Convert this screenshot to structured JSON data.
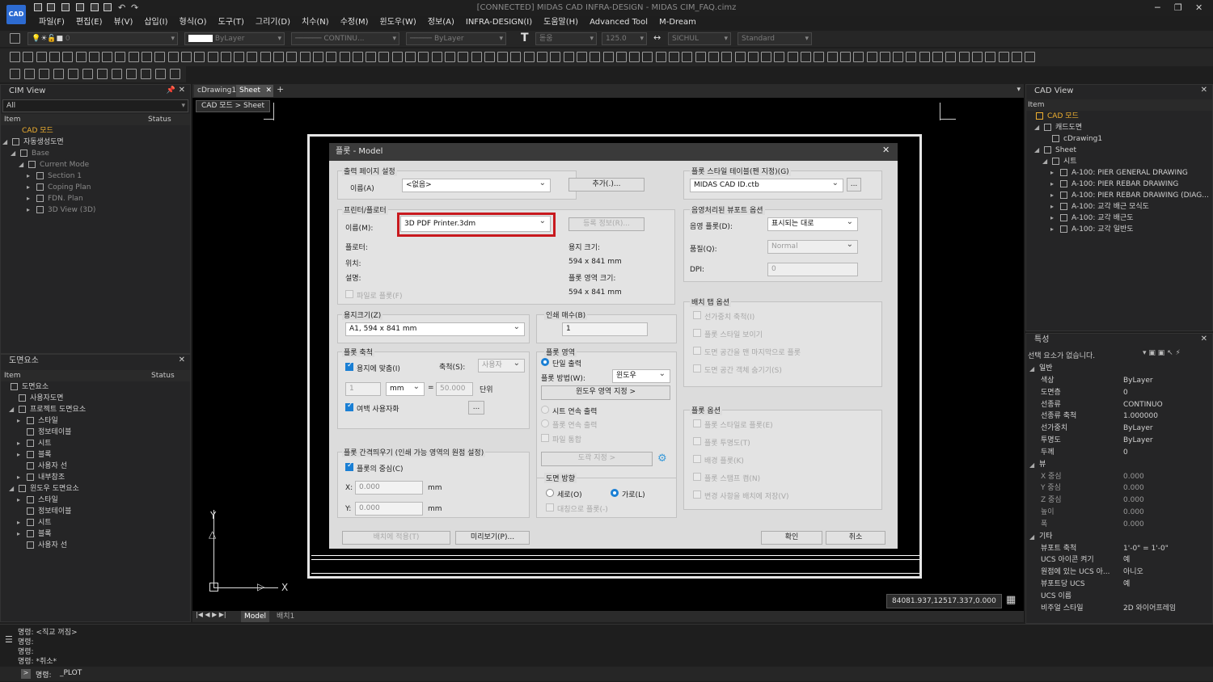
{
  "app": {
    "title": "[CONNECTED] MIDAS CAD INFRA-DESIGN - MIDAS CIM_FAQ.cimz",
    "logo": "CAD"
  },
  "menu": [
    "파일(F)",
    "편집(E)",
    "뷰(V)",
    "삽입(I)",
    "형식(O)",
    "도구(T)",
    "그리기(D)",
    "치수(N)",
    "수정(M)",
    "윈도우(W)",
    "정보(A)",
    "INFRA-DESIGN(I)",
    "도움말(H)",
    "Advanced Tool",
    "M-Dream"
  ],
  "toolbar": {
    "layer": "0",
    "color": "ByLayer",
    "linetype": "CONTINU...",
    "lineweight": "ByLayer",
    "textstyle": "돋움",
    "textheight": "125.0",
    "dimstyle": "SICHUL",
    "style2": "Standard"
  },
  "cim_view": {
    "title": "CIM View",
    "filter": "All",
    "col_item": "Item",
    "col_status": "Status",
    "items": [
      {
        "label": "CAD 모드",
        "level": 0
      },
      {
        "label": "자동생성도면",
        "level": 0
      },
      {
        "label": "Base",
        "level": 1
      },
      {
        "label": "Current Mode",
        "level": 2
      },
      {
        "label": "Section 1",
        "level": 3
      },
      {
        "label": "Coping Plan",
        "level": 3
      },
      {
        "label": "FDN. Plan",
        "level": 3
      },
      {
        "label": "3D View (3D)",
        "level": 3
      }
    ]
  },
  "drawing_elements": {
    "title": "도면요소",
    "col_item": "Item",
    "col_status": "Status",
    "items": [
      {
        "label": "도면요소",
        "level": 0
      },
      {
        "label": "사용자도면",
        "level": 1
      },
      {
        "label": "프로젝트 도면요소",
        "level": 1
      },
      {
        "label": "스타일",
        "level": 2
      },
      {
        "label": "정보테이블",
        "level": 2
      },
      {
        "label": "시트",
        "level": 2
      },
      {
        "label": "블록",
        "level": 2
      },
      {
        "label": "사용자 선",
        "level": 2
      },
      {
        "label": "내부참조",
        "level": 2
      },
      {
        "label": "윈도우 도면요소",
        "level": 1
      },
      {
        "label": "스타일",
        "level": 2
      },
      {
        "label": "정보테이블",
        "level": 2
      },
      {
        "label": "시트",
        "level": 2
      },
      {
        "label": "블록",
        "level": 2
      },
      {
        "label": "사용자 선",
        "level": 2
      }
    ]
  },
  "tabs": [
    "cDrawing1",
    "Sheet"
  ],
  "breadcrumb": "CAD 모드 > Sheet",
  "plot": {
    "title": "플롯 - Model",
    "page_setup": {
      "group": "출력 페이지 설정",
      "name_label": "이름(A)",
      "name_value": "<없음>",
      "add_button": "추가(.)..."
    },
    "printer": {
      "group": "프린터/플로터",
      "name_label": "이름(M):",
      "name_value": "3D PDF Printer.3dm",
      "props_button": "등록 정보(R)...",
      "plotter_label": "플로터:",
      "location_label": "위치:",
      "description_label": "설명:",
      "plot_to_file": "파일로 플롯(F)",
      "paper_size_label": "용지 크기:",
      "paper_size_value": "594 x 841 mm",
      "plot_area_label": "플롯 영역 크기:",
      "plot_area_value": "594 x 841 mm"
    },
    "paper_size": {
      "group": "용지크기(Z)",
      "value": "A1, 594 x 841 mm"
    },
    "copies": {
      "group": "인쇄 매수(B)",
      "value": "1"
    },
    "plot_scale": {
      "group": "플롯 축척",
      "fit": "용지에 맞춤(I)",
      "scale_label": "축척(S):",
      "scale_value": "사용자",
      "value1": "1",
      "unit": "mm",
      "equals": "=",
      "value2": "50.000",
      "unit_label": "단위",
      "margin": "여백 사용자화"
    },
    "plot_area": {
      "group": "플롯 영역",
      "single": "단일 출력",
      "method_label": "플롯 방법(W):",
      "method_value": "윈도우",
      "window_button": "윈도우 영역 지정 >",
      "sheet_series": "시트 연속 출력",
      "sheet_series2": "플롯 연속 출력",
      "merge": "파일 통합",
      "frame_button": "도곽 지정 >"
    },
    "offset": {
      "group": "플롯 간격띄우기 (인쇄 가능 영역의 원점 설정)",
      "center": "플롯의 중심(C)",
      "x_label": "X:",
      "x_value": "0.000",
      "y_label": "Y:",
      "y_value": "0.000",
      "unit": "mm"
    },
    "orientation": {
      "group": "도면 방향",
      "portrait": "세로(O)",
      "landscape": "가로(L)",
      "upside": "대칭으로 플롯(-)"
    },
    "style_table": {
      "group": "플롯 스타일 테이블(펜 지정)(G)",
      "value": "MIDAS CAD ID.ctb"
    },
    "shaded": {
      "group": "음영처리된 뷰포트 옵션",
      "shade_label": "음영 플롯(D):",
      "shade_value": "표시되는 대로",
      "quality_label": "품질(Q):",
      "quality_value": "Normal",
      "dpi_label": "DPI:",
      "dpi_value": "0"
    },
    "layout_options": {
      "group": "배치 탭 옵션",
      "opts": [
        "선가중치 축척(I)",
        "플롯 스타일 보이기",
        "도면 공간을 맨 마지막으로 플롯",
        "도면 공간 객체 숨기기(S)"
      ]
    },
    "plot_options": {
      "group": "플롯 옵션",
      "opts": [
        "플롯 스타일로 플롯(E)",
        "플롯 투명도(T)",
        "배경 플롯(K)",
        "플롯 스탬프 켬(N)",
        "변경 사항을 배치에 저장(V)"
      ]
    },
    "buttons": {
      "apply": "배치에 적용(T)",
      "preview": "미리보기(P)...",
      "ok": "확인",
      "cancel": "취소"
    }
  },
  "cad_view": {
    "title": "CAD View",
    "col_item": "Item",
    "items": [
      {
        "label": "CAD 모드",
        "level": 0
      },
      {
        "label": "캐드도면",
        "level": 1
      },
      {
        "label": "cDrawing1",
        "level": 2
      },
      {
        "label": "Sheet",
        "level": 1
      },
      {
        "label": "시트",
        "level": 2
      },
      {
        "label": "A-100: PIER GENERAL DRAWING",
        "level": 3
      },
      {
        "label": "A-100: PIER REBAR DRAWING",
        "level": 3
      },
      {
        "label": "A-100: PIER REBAR DRAWING (DIAG...",
        "level": 3
      },
      {
        "label": "A-100: 교각 배근 모식도",
        "level": 3
      },
      {
        "label": "A-100: 교각 배근도",
        "level": 3
      },
      {
        "label": "A-100: 교각 일반도",
        "level": 3
      }
    ]
  },
  "properties": {
    "title": "특성",
    "selection": "선택 요소가 없습니다.",
    "groups": [
      {
        "name": "일반",
        "rows": [
          [
            "색상",
            "ByLayer"
          ],
          [
            "도면층",
            "0"
          ],
          [
            "선종류",
            "CONTINUO"
          ],
          [
            "선종류 축척",
            "1.000000"
          ],
          [
            "선가중치",
            "ByLayer"
          ],
          [
            "투명도",
            "ByLayer"
          ],
          [
            "두께",
            "0"
          ]
        ]
      },
      {
        "name": "뷰",
        "rows": [
          [
            "X 중심",
            "0.000"
          ],
          [
            "Y 중심",
            "0.000"
          ],
          [
            "Z 중심",
            "0.000"
          ],
          [
            "높이",
            "0.000"
          ],
          [
            "폭",
            "0.000"
          ]
        ]
      },
      {
        "name": "기타",
        "rows": [
          [
            "뷰포트 축척",
            "1'-0\" = 1'-0\""
          ],
          [
            "UCS 아이콘 켜기",
            "예"
          ],
          [
            "원점에 있는 UCS 아...",
            "아니오"
          ],
          [
            "뷰포트당 UCS",
            "예"
          ],
          [
            "UCS 이름",
            ""
          ],
          [
            "비주얼 스타일",
            "2D 와이어프레임"
          ]
        ]
      }
    ]
  },
  "layout_tabs": {
    "model": "Model",
    "layout1": "배치1"
  },
  "coords": "84081.937,12517.337,0.000",
  "axis": {
    "x": "X",
    "y": "Y"
  },
  "command": {
    "lines": [
      "명령: <직교 꺼짐>",
      "명령:",
      "명령:",
      "명령: *취소*"
    ],
    "prompt": "명령:",
    "input": "_PLOT"
  }
}
